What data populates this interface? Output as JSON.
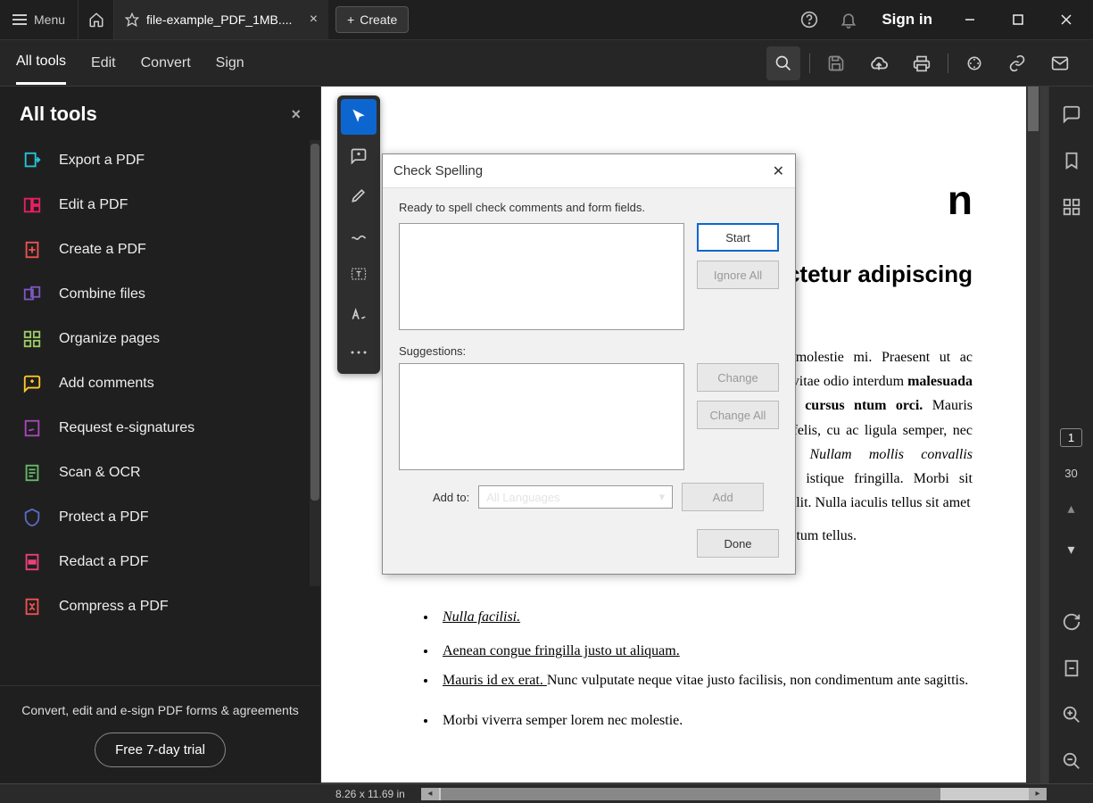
{
  "titlebar": {
    "menu_label": "Menu",
    "tab_title": "file-example_PDF_1MB....",
    "create_label": "Create",
    "signin": "Sign in"
  },
  "toolbar": {
    "tabs": [
      "All tools",
      "Edit",
      "Convert",
      "Sign"
    ]
  },
  "sidebar": {
    "title": "All tools",
    "items": [
      {
        "label": "Export a PDF"
      },
      {
        "label": "Edit a PDF"
      },
      {
        "label": "Create a PDF"
      },
      {
        "label": "Combine files"
      },
      {
        "label": "Organize pages"
      },
      {
        "label": "Add comments"
      },
      {
        "label": "Request e-signatures"
      },
      {
        "label": "Scan & OCR"
      },
      {
        "label": "Protect a PDF"
      },
      {
        "label": "Redact a PDF"
      },
      {
        "label": "Compress a PDF"
      }
    ],
    "footer_text": "Convert, edit and e-sign PDF forms & agreements",
    "trial_label": "Free 7-day trial"
  },
  "dialog": {
    "title": "Check Spelling",
    "message": "Ready to spell check comments and form fields.",
    "suggestions_label": "Suggestions:",
    "start": "Start",
    "ignore_all": "Ignore All",
    "change": "Change",
    "change_all": "Change All",
    "add_to_label": "Add to:",
    "add_to_value": "All Languages",
    "add": "Add",
    "done": "Done"
  },
  "document": {
    "heading_visible_right": "n",
    "subheading_visible_right": "ctetur adipiscing",
    "para_parts": {
      "a": "ngue molestie mi. Praesent ut ac dolor vitae odio interdum ",
      "b": "malesuada ipsum cursus ntum orci.",
      "c": " Mauris diam felis, cu ac ligula semper, nec luctus ",
      "d": "Nullam mollis convallis ipsum,",
      "e": " istique fringilla. Morbi sit amet elit. Nulla iaculis tellus sit amet",
      "f": "ctum tellus.",
      "g": "."
    },
    "bullets": {
      "b1_i": "Nulla facilisi.",
      "b2_u": "Aenean congue fringilla justo ut aliquam. ",
      "b3_u": "Mauris id ex erat. ",
      "b3_rest": "Nunc vulputate neque vitae justo facilisis, non condimentum ante sagittis.",
      "b4": "Morbi viverra semper lorem nec molestie."
    }
  },
  "page_indicator": {
    "current": "1",
    "total": "30"
  },
  "status": {
    "size": "8.26 x 11.69 in"
  }
}
